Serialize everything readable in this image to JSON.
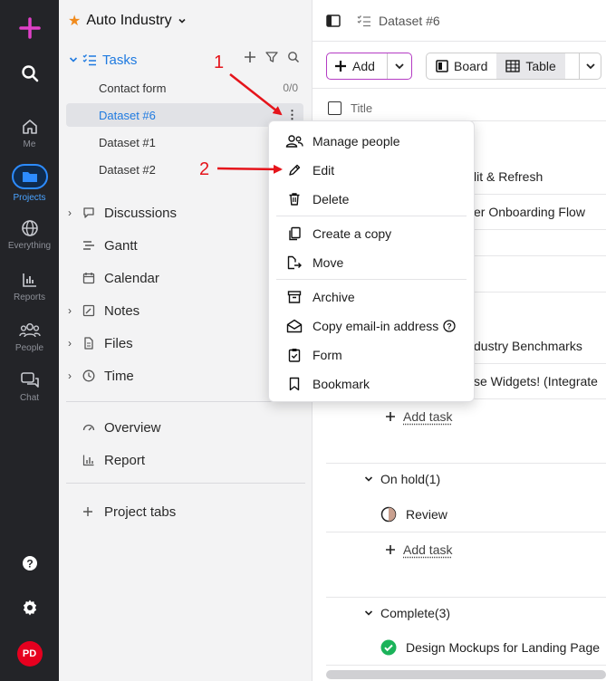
{
  "rail": {
    "items": [
      {
        "label": "Me"
      },
      {
        "label": "Projects"
      },
      {
        "label": "Everything"
      },
      {
        "label": "Reports"
      },
      {
        "label": "People"
      },
      {
        "label": "Chat"
      }
    ],
    "avatar_initials": "PD"
  },
  "sidebar": {
    "project_name": "Auto Industry",
    "tasks_label": "Tasks",
    "task_items": [
      {
        "label": "Contact form",
        "meta": "0/0"
      },
      {
        "label": "Dataset #6",
        "meta": ""
      },
      {
        "label": "Dataset #1",
        "meta": ""
      },
      {
        "label": "Dataset #2",
        "meta": ""
      }
    ],
    "nav": [
      {
        "label": "Discussions"
      },
      {
        "label": "Gantt"
      },
      {
        "label": "Calendar"
      },
      {
        "label": "Notes"
      },
      {
        "label": "Files"
      },
      {
        "label": "Time"
      }
    ],
    "nav2": [
      {
        "label": "Overview"
      },
      {
        "label": "Report"
      }
    ],
    "project_tabs": "Project tabs"
  },
  "topbar": {
    "breadcrumb": "Dataset #6"
  },
  "toolbar": {
    "add_label": "Add",
    "board_label": "Board",
    "table_label": "Table"
  },
  "table": {
    "title_header": "Title",
    "rows": [
      "lit & Refresh",
      "er Onboarding Flow",
      "dustry Benchmarks",
      "se Widgets! (Integrate"
    ],
    "add_task_label": "Add task",
    "groups": [
      {
        "label": "On hold(1)",
        "tasks": [
          "Review"
        ]
      },
      {
        "label": "Complete(3)",
        "tasks": [
          "Design Mockups for Landing Page"
        ]
      }
    ]
  },
  "menu": {
    "items": [
      {
        "label": "Manage people"
      },
      {
        "label": "Edit"
      },
      {
        "label": "Delete"
      },
      {
        "label": "Create a copy"
      },
      {
        "label": "Move"
      },
      {
        "label": "Archive"
      },
      {
        "label": "Copy email-in address"
      },
      {
        "label": "Form"
      },
      {
        "label": "Bookmark"
      }
    ]
  },
  "annotations": {
    "one": "1",
    "two": "2"
  },
  "colors": {
    "accent_blue": "#1f7ae0",
    "plus_magenta": "#e040c8",
    "add_border": "#b43cc4",
    "annotation_red": "#e5141b",
    "complete_green": "#1bb35a"
  }
}
